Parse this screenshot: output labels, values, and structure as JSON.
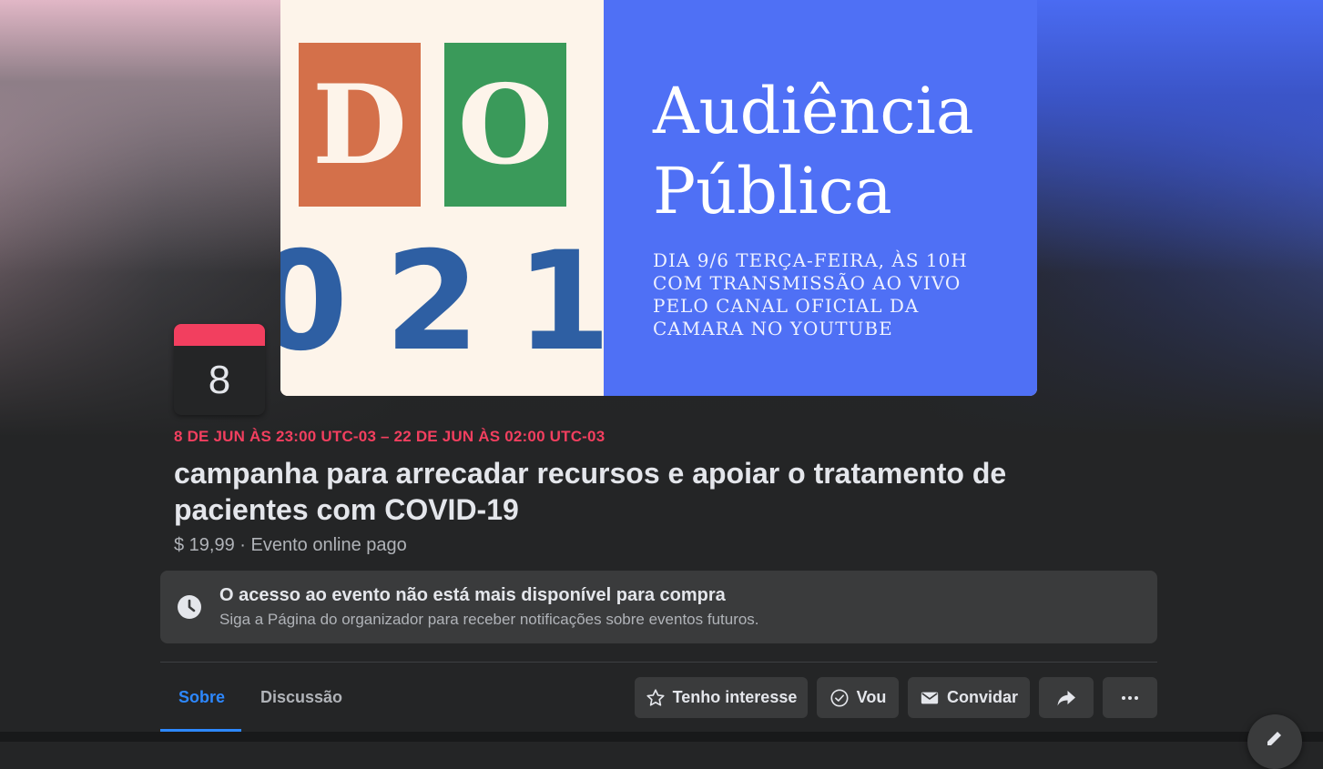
{
  "cover": {
    "tile_letters": [
      "D",
      "O"
    ],
    "digits": "021",
    "title_lines": [
      "Audiência",
      "Pública"
    ],
    "subtitle_lines": [
      "DIA 9/6 TERÇA-FEIRA, ÀS 10H",
      "COM TRANSMISSÃO AO VIVO",
      "PELO CANAL OFICIAL DA",
      "CAMARA NO YOUTUBE"
    ]
  },
  "event": {
    "date_badge_day": "8",
    "date_range": "8 DE JUN ÀS 23:00 UTC-03 – 22 DE JUN ÀS 02:00 UTC-03",
    "title": "campanha para arrecadar recursos e apoiar o tratamento de pacientes com COVID-19",
    "meta": "$ 19,99 · Evento online pago"
  },
  "notice": {
    "icon": "clock-icon",
    "title": "O acesso ao evento não está mais disponível para compra",
    "subtitle": "Siga a Página do organizador para receber notificações sobre eventos futuros."
  },
  "tabs": [
    {
      "label": "Sobre",
      "active": true
    },
    {
      "label": "Discussão",
      "active": false
    }
  ],
  "actions": {
    "interested_label": "Tenho interesse",
    "going_label": "Vou",
    "invite_label": "Convidar",
    "share_icon": "share-icon",
    "more_icon": "more-icon"
  },
  "colors": {
    "accent": "#2d88ff",
    "date_red": "#f23f5f",
    "background": "#242526",
    "surface": "#3a3b3c"
  }
}
